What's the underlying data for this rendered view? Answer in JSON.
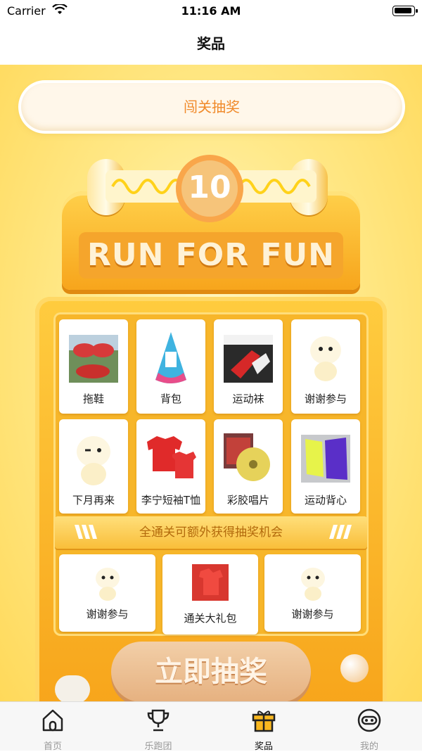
{
  "status_bar": {
    "carrier": "Carrier",
    "time": "11:16 AM"
  },
  "header": {
    "title": "奖品"
  },
  "challenge_button": "闯关抽奖",
  "machine": {
    "badge": "10",
    "slogan": "RUN FOR FUN"
  },
  "prizes_row1": [
    {
      "label": "拖鞋",
      "icon": "slippers-image"
    },
    {
      "label": "背包",
      "icon": "backpack-image"
    },
    {
      "label": "运动袜",
      "icon": "socks-image"
    },
    {
      "label": "谢谢参与",
      "icon": "mascot-image"
    }
  ],
  "prizes_row2": [
    {
      "label": "下月再来",
      "icon": "mascot-wink-image"
    },
    {
      "label": "李宁短袖T恤",
      "icon": "tshirt-image"
    },
    {
      "label": "彩胶唱片",
      "icon": "vinyl-image"
    },
    {
      "label": "运动背心",
      "icon": "vest-image"
    }
  ],
  "bonus_banner": "全通关可额外获得抽奖机会",
  "prizes_row3": [
    {
      "label": "谢谢参与",
      "icon": "mascot-image"
    },
    {
      "label": "通关大礼包",
      "icon": "gift-pack-image"
    },
    {
      "label": "谢谢参与",
      "icon": "mascot-image"
    }
  ],
  "draw_button": "立即抽奖",
  "tabs": [
    {
      "label": "首页",
      "icon": "home-icon"
    },
    {
      "label": "乐跑团",
      "icon": "trophy-icon"
    },
    {
      "label": "奖品",
      "icon": "gift-icon",
      "active": true
    },
    {
      "label": "我的",
      "icon": "profile-icon"
    }
  ],
  "colors": {
    "accent": "#f08a2a",
    "machine": "#f7a51c",
    "tab_active": "#111111"
  }
}
